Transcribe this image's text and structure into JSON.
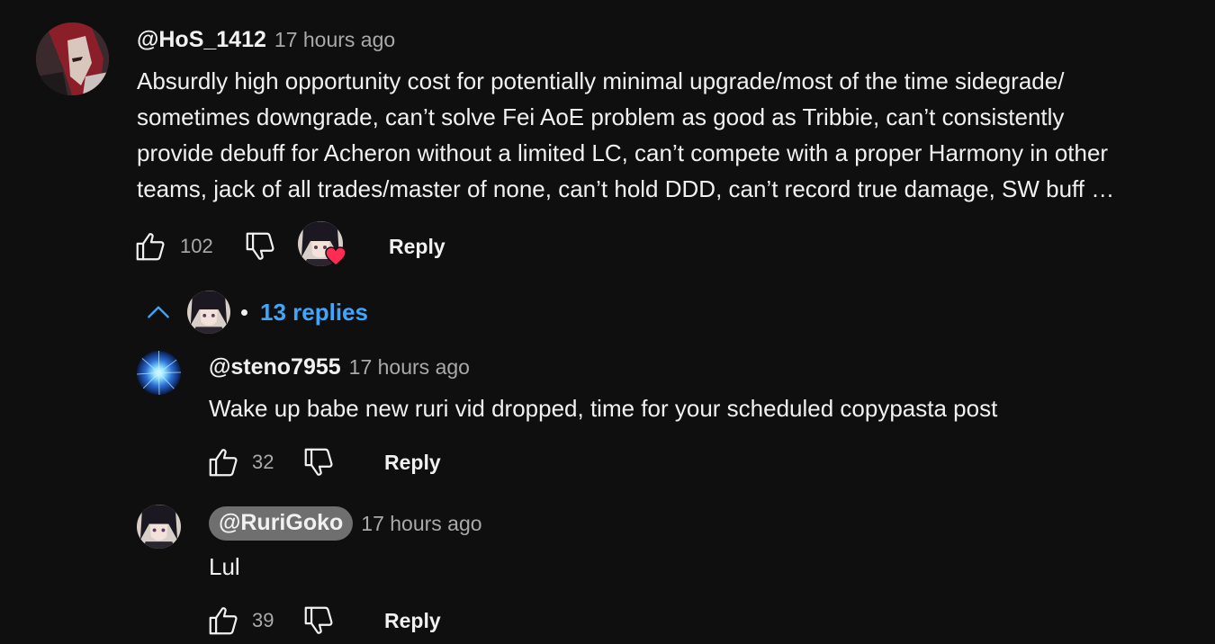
{
  "comment": {
    "author": "@HoS_1412",
    "time": "17 hours ago",
    "text_lines": [
      "Absurdly high opportunity cost for potentially minimal upgrade/most of the time sidegrade/",
      "sometimes downgrade, can’t solve Fei AoE problem as good as Tribbie, can’t consistently",
      "provide debuff for Acheron without a limited LC, can’t compete with a proper Harmony in other",
      "teams, jack of all trades/master of none, can’t hold DDD, can’t record true damage, SW buff …"
    ],
    "likes": "102",
    "reply_label": "Reply",
    "avatar_icon": "profile-avatar",
    "hearted_by_creator": true
  },
  "replies_toggle": {
    "label": "13 replies",
    "icon": "chevron-up-icon",
    "color": "#3ea6ff"
  },
  "replies": [
    {
      "author": "@steno7955",
      "time": "17 hours ago",
      "text": "Wake up babe new ruri vid dropped, time for your scheduled copypasta post",
      "likes": "32",
      "reply_label": "Reply",
      "is_creator": false
    },
    {
      "author": "@RuriGoko",
      "time": "17 hours ago",
      "text": "Lul",
      "likes": "39",
      "reply_label": "Reply",
      "is_creator": true
    }
  ],
  "colors": {
    "background": "#0f0f0f",
    "text": "#f1f1f1",
    "secondary": "#aaaaaa",
    "link": "#3ea6ff",
    "heart": "#ff2d55",
    "creator_pill": "#6f6f6f"
  }
}
